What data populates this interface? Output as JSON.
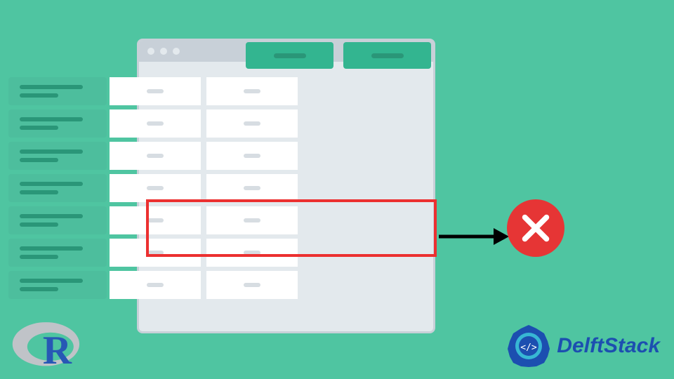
{
  "diagram": {
    "concept": "remove-rows-from-dataframe",
    "window": {
      "traffic_light_dots": 3,
      "table": {
        "column_headers": 2,
        "row_count": 7,
        "cells_per_row": 2,
        "highlighted_rows": [
          5,
          6
        ],
        "highlight_action": "delete"
      }
    }
  },
  "logos": {
    "r_lang": "R",
    "delftstack": "DelftStack"
  },
  "colors": {
    "background": "#4fc5a1",
    "window_frame": "#c8d0d8",
    "window_body": "#e3e9ed",
    "header_cell": "#33b590",
    "row_header": "#4dbe9d",
    "data_cell": "#ffffff",
    "highlight_border": "#ec3030",
    "delete_circle": "#e63535",
    "brand_blue": "#1c4fb0"
  }
}
